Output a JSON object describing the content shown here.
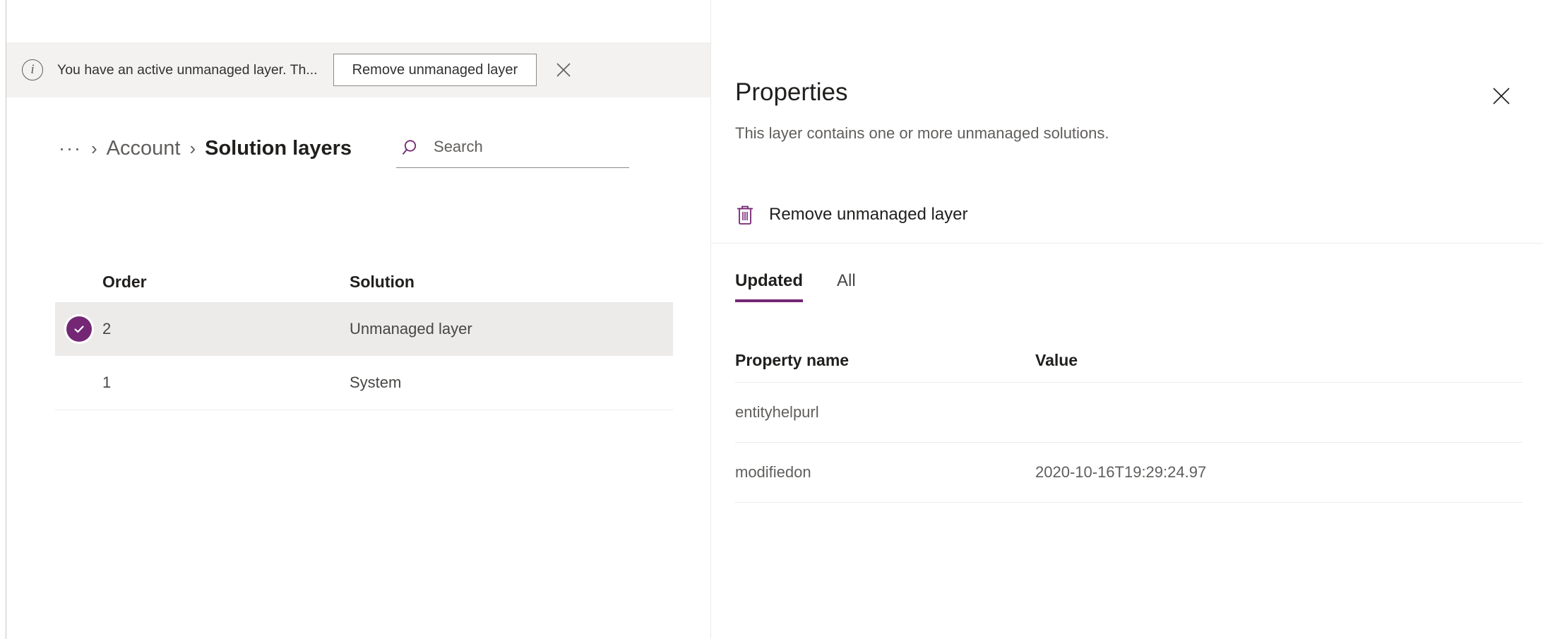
{
  "message_bar": {
    "icon": "info-circle-icon",
    "text": "You have an active unmanaged layer. Th...",
    "action_label": "Remove unmanaged layer",
    "close_icon": "close-icon"
  },
  "breadcrumb": {
    "ellipsis": "···",
    "separator": "›",
    "parent": "Account",
    "current": "Solution layers"
  },
  "search": {
    "icon": "search-icon",
    "placeholder": "Search",
    "value": ""
  },
  "layers_table": {
    "columns": [
      "Order",
      "Solution"
    ],
    "rows": [
      {
        "order": "2",
        "solution": "Unmanaged layer",
        "selected": true,
        "check_icon": "check-circle-icon"
      },
      {
        "order": "1",
        "solution": "System",
        "selected": false
      }
    ]
  },
  "panel": {
    "title": "Properties",
    "subtitle": "This layer contains one or more unmanaged solutions.",
    "close_icon": "close-icon",
    "command": {
      "icon": "trash-icon",
      "label": "Remove unmanaged layer"
    },
    "tabs": [
      {
        "label": "Updated",
        "active": true
      },
      {
        "label": "All",
        "active": false
      }
    ],
    "property_table": {
      "columns": [
        "Property name",
        "Value"
      ],
      "rows": [
        {
          "name": "entityhelpurl",
          "value": ""
        },
        {
          "name": "modifiedon",
          "value": "2020-10-16T19:29:24.97"
        }
      ]
    }
  },
  "colors": {
    "accent": "#742774",
    "message_bar_bg": "#f3f2f1",
    "row_selected_bg": "#edebe9",
    "text_primary": "#201f1e",
    "text_secondary": "#605e5c"
  }
}
